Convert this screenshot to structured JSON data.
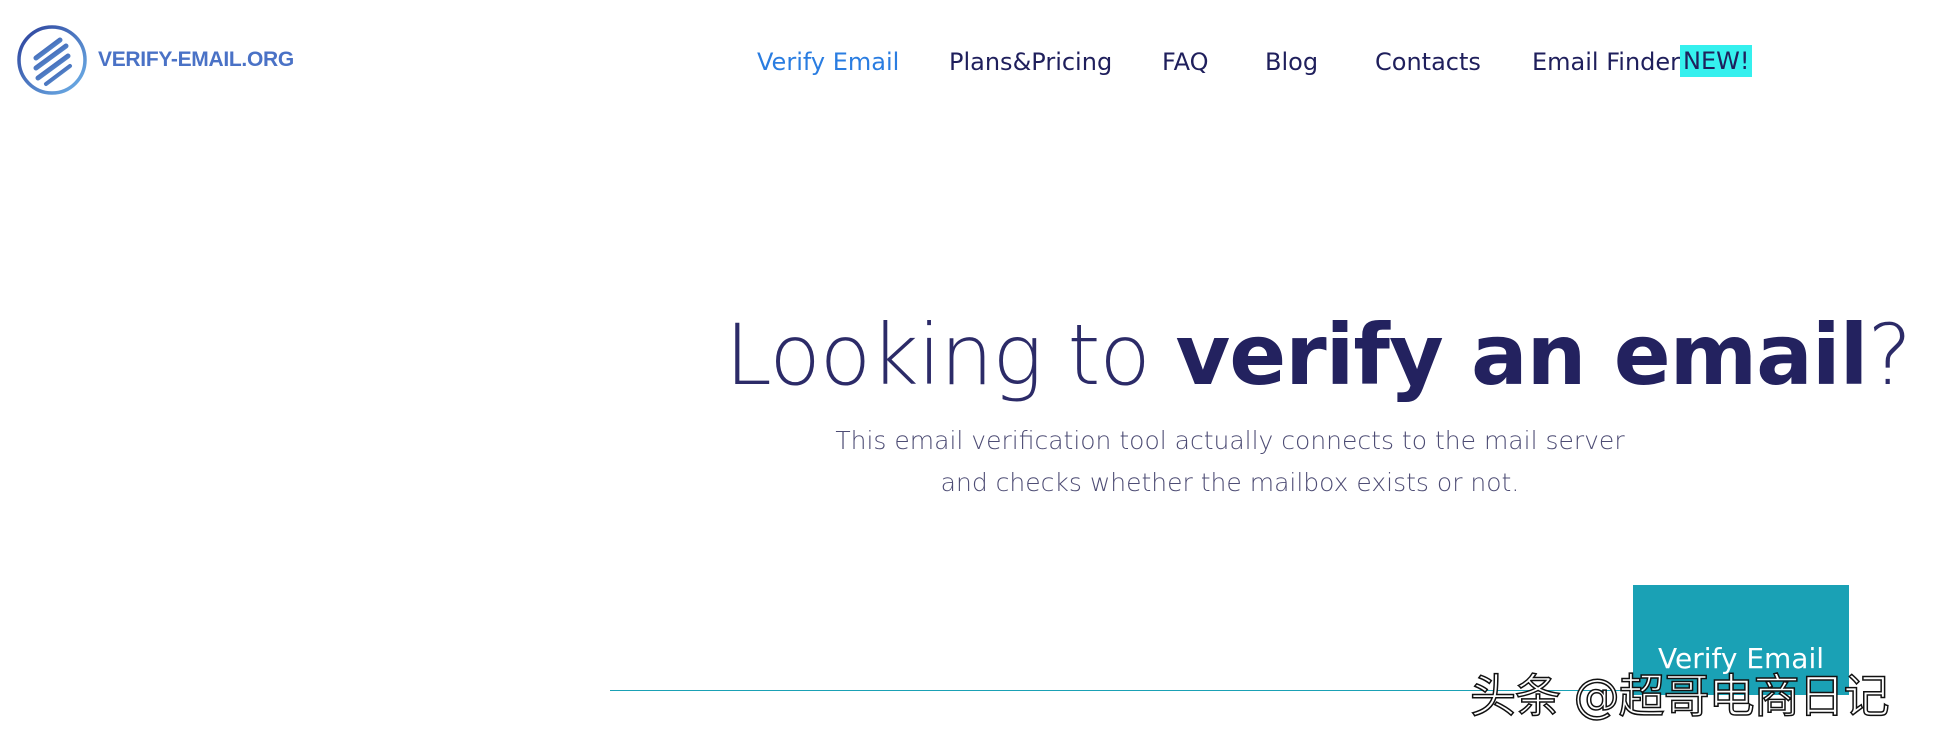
{
  "header": {
    "logo_text": "VERIFY-EMAIL.ORG",
    "logo_icon": "stacked-lines-circle-logo-icon",
    "brand_color": "#4a72c6"
  },
  "nav": {
    "items": [
      {
        "label": "Verify Email",
        "active": true
      },
      {
        "label": "Plans&Pricing",
        "active": false
      },
      {
        "label": "FAQ",
        "active": false
      },
      {
        "label": "Blog",
        "active": false
      },
      {
        "label": "Contacts",
        "active": false
      },
      {
        "label": "Email Finder",
        "active": false
      }
    ],
    "badge": "NEW!",
    "badge_color": "#35f0ee",
    "active_color": "#2a7de1"
  },
  "hero": {
    "title_prefix": "Looking to ",
    "title_bold": "verify an email",
    "title_suffix": "?",
    "subtitle_line1": "This email verification tool actually connects to the mail server",
    "subtitle_line2": "and checks whether the mailbox exists or not."
  },
  "form": {
    "input_value": "",
    "button_label": "Verify Email",
    "accent_color": "#1aa1b5"
  },
  "watermark": {
    "text": "头条 @超哥电商日记"
  }
}
